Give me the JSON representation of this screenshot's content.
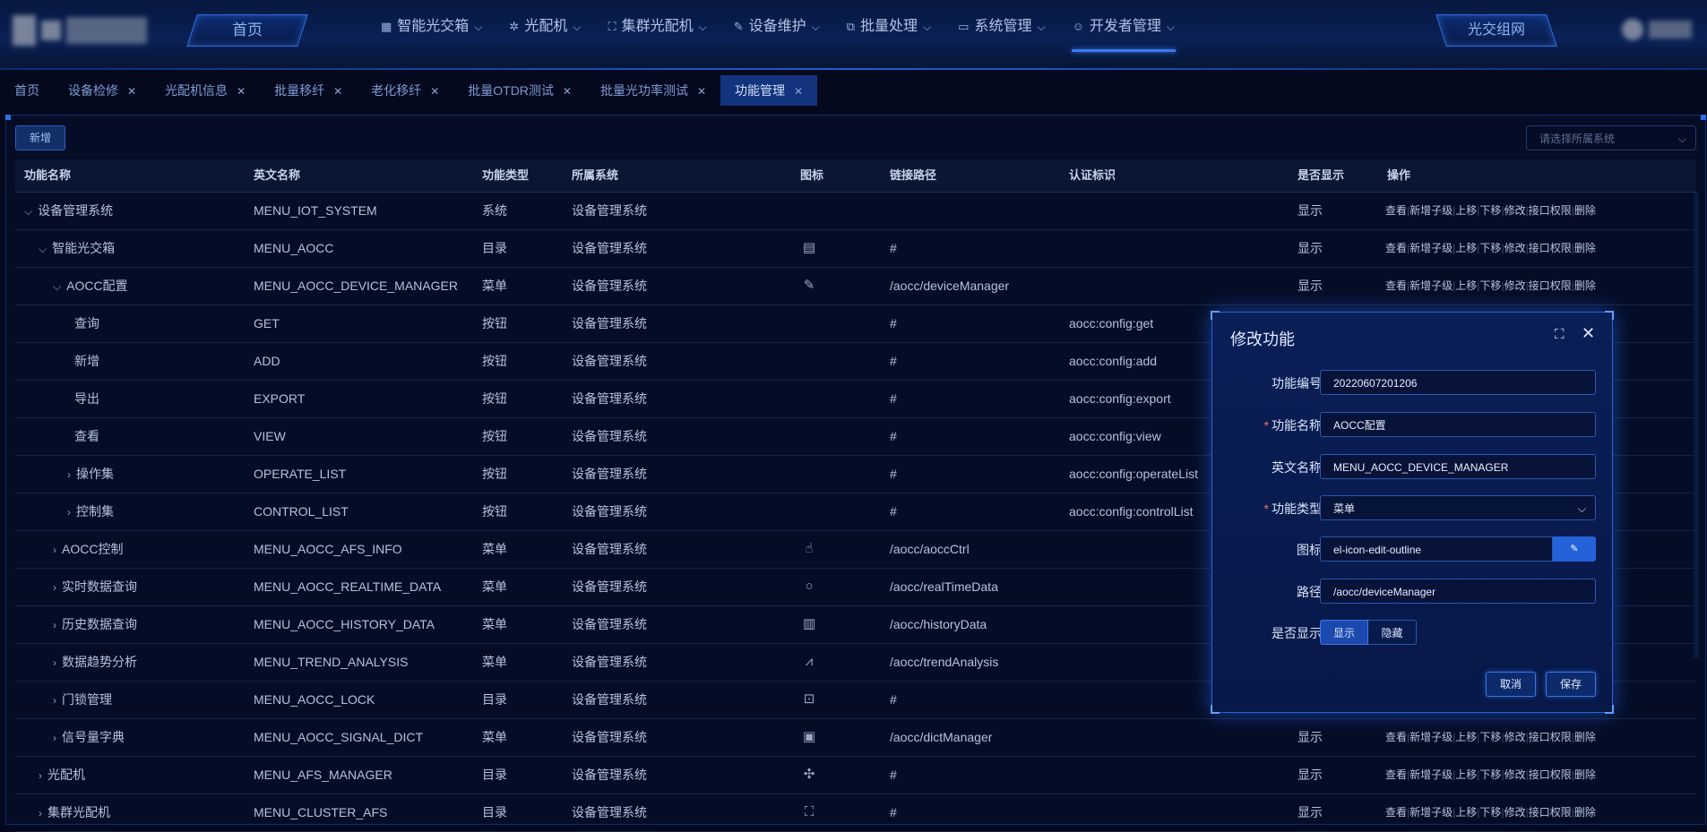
{
  "nav": {
    "home": "首页",
    "items": [
      {
        "icon": "▦",
        "label": "智能光交箱"
      },
      {
        "icon": "✲",
        "label": "光配机"
      },
      {
        "icon": "⛶",
        "label": "集群光配机"
      },
      {
        "icon": "✎",
        "label": "设备维护"
      },
      {
        "icon": "⧉",
        "label": "批量处理"
      },
      {
        "icon": "▭",
        "label": "系统管理"
      },
      {
        "icon": "☺",
        "label": "开发者管理"
      }
    ],
    "right_button": "光交组网"
  },
  "tabs": [
    {
      "label": "首页",
      "closable": false
    },
    {
      "label": "设备检修",
      "closable": true
    },
    {
      "label": "光配机信息",
      "closable": true
    },
    {
      "label": "批量移纤",
      "closable": true
    },
    {
      "label": "老化移纤",
      "closable": true
    },
    {
      "label": "批量OTDR测试",
      "closable": true
    },
    {
      "label": "批量光功率测试",
      "closable": true
    },
    {
      "label": "功能管理",
      "closable": true,
      "active": true
    }
  ],
  "toolbar": {
    "add_label": "新增",
    "system_placeholder": "请选择所属系统"
  },
  "table": {
    "headers": [
      "功能名称",
      "英文名称",
      "功能类型",
      "所属系统",
      "图标",
      "链接路径",
      "认证标识",
      "是否显示",
      "操作"
    ],
    "ops": [
      "查看",
      "新增子级",
      "上移",
      "下移",
      "修改",
      "接口权限",
      "删除"
    ],
    "rows": [
      {
        "name": "设备管理系统",
        "arrow": "⌄",
        "en": "MENU_IOT_SYSTEM",
        "type": "系统",
        "sys": "设备管理系统",
        "icon": "",
        "path": "",
        "auth": "",
        "show": "显示"
      },
      {
        "name": "智能光交箱",
        "arrow": "⌄",
        "en": "MENU_AOCC",
        "type": "目录",
        "sys": "设备管理系统",
        "icon": "▤",
        "path": "#",
        "auth": "",
        "show": "显示"
      },
      {
        "name": "AOCC配置",
        "arrow": "⌄",
        "en": "MENU_AOCC_DEVICE_MANAGER",
        "type": "菜单",
        "sys": "设备管理系统",
        "icon": "✎",
        "path": "/aocc/deviceManager",
        "auth": "",
        "show": "显示"
      },
      {
        "name": "查询",
        "arrow": "",
        "en": "GET",
        "type": "按钮",
        "sys": "设备管理系统",
        "icon": "",
        "path": "#",
        "auth": "aocc:config:get",
        "show": ""
      },
      {
        "name": "新增",
        "arrow": "",
        "en": "ADD",
        "type": "按钮",
        "sys": "设备管理系统",
        "icon": "",
        "path": "#",
        "auth": "aocc:config:add",
        "show": ""
      },
      {
        "name": "导出",
        "arrow": "",
        "en": "EXPORT",
        "type": "按钮",
        "sys": "设备管理系统",
        "icon": "",
        "path": "#",
        "auth": "aocc:config:export",
        "show": ""
      },
      {
        "name": "查看",
        "arrow": "",
        "en": "VIEW",
        "type": "按钮",
        "sys": "设备管理系统",
        "icon": "",
        "path": "#",
        "auth": "aocc:config:view",
        "show": ""
      },
      {
        "name": "操作集",
        "arrow": "›",
        "en": "OPERATE_LIST",
        "type": "按钮",
        "sys": "设备管理系统",
        "icon": "",
        "path": "#",
        "auth": "aocc:config:operateList",
        "show": ""
      },
      {
        "name": "控制集",
        "arrow": "›",
        "en": "CONTROL_LIST",
        "type": "按钮",
        "sys": "设备管理系统",
        "icon": "",
        "path": "#",
        "auth": "aocc:config:controlList",
        "show": ""
      },
      {
        "name": "AOCC控制",
        "arrow": "›",
        "en": "MENU_AOCC_AFS_INFO",
        "type": "菜单",
        "sys": "设备管理系统",
        "icon": "☝",
        "path": "/aocc/aoccCtrl",
        "auth": "",
        "show": ""
      },
      {
        "name": "实时数据查询",
        "arrow": "›",
        "en": "MENU_AOCC_REALTIME_DATA",
        "type": "菜单",
        "sys": "设备管理系统",
        "icon": "○",
        "path": "/aocc/realTimeData",
        "auth": "",
        "show": ""
      },
      {
        "name": "历史数据查询",
        "arrow": "›",
        "en": "MENU_AOCC_HISTORY_DATA",
        "type": "菜单",
        "sys": "设备管理系统",
        "icon": "▥",
        "path": "/aocc/historyData",
        "auth": "",
        "show": ""
      },
      {
        "name": "数据趋势分析",
        "arrow": "›",
        "en": "MENU_TREND_ANALYSIS",
        "type": "菜单",
        "sys": "设备管理系统",
        "icon": "⩘",
        "path": "/aocc/trendAnalysis",
        "auth": "",
        "show": ""
      },
      {
        "name": "门锁管理",
        "arrow": "›",
        "en": "MENU_AOCC_LOCK",
        "type": "目录",
        "sys": "设备管理系统",
        "icon": "⊡",
        "path": "#",
        "auth": "",
        "show": ""
      },
      {
        "name": "信号量字典",
        "arrow": "›",
        "en": "MENU_AOCC_SIGNAL_DICT",
        "type": "菜单",
        "sys": "设备管理系统",
        "icon": "▣",
        "path": "/aocc/dictManager",
        "auth": "",
        "show": "显示"
      },
      {
        "name": "光配机",
        "arrow": "›",
        "en": "MENU_AFS_MANAGER",
        "type": "目录",
        "sys": "设备管理系统",
        "icon": "✣",
        "path": "#",
        "auth": "",
        "show": "显示"
      },
      {
        "name": "集群光配机",
        "arrow": "›",
        "en": "MENU_CLUSTER_AFS",
        "type": "目录",
        "sys": "设备管理系统",
        "icon": "⛶",
        "path": "#",
        "auth": "",
        "show": "显示"
      }
    ]
  },
  "dialog": {
    "title": "修改功能",
    "fields": {
      "code": {
        "label": "功能编号",
        "value": "20220607201206"
      },
      "name": {
        "label": "功能名称",
        "value": "AOCC配置"
      },
      "en": {
        "label": "英文名称",
        "value": "MENU_AOCC_DEVICE_MANAGER"
      },
      "type": {
        "label": "功能类型",
        "value": "菜单"
      },
      "icon": {
        "label": "图标",
        "value": "el-icon-edit-outline"
      },
      "path": {
        "label": "路径",
        "value": "/aocc/deviceManager"
      },
      "show": {
        "label": "是否显示",
        "on": "显示",
        "off": "隐藏"
      }
    },
    "cancel": "取消",
    "save": "保存"
  }
}
